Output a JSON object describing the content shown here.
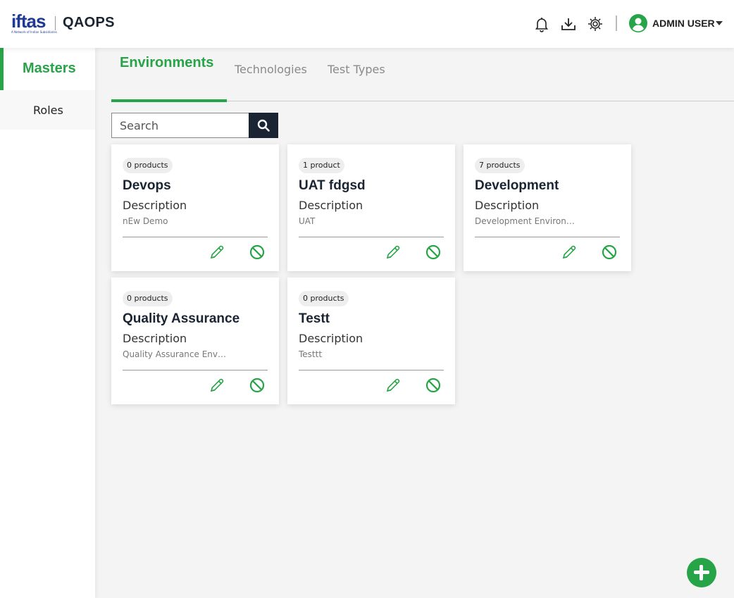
{
  "header": {
    "logo_text": "iftas",
    "logo_subtitle": "A Network of Indian Subsidiaries",
    "app_name": "QAOPS",
    "user_name": "ADMIN USER",
    "icons": [
      "bell-icon",
      "download-icon",
      "settings-icon",
      "user-avatar-icon",
      "caret-down-icon"
    ]
  },
  "sidebar": {
    "items": [
      {
        "label": "Masters",
        "active": true
      },
      {
        "label": "Roles",
        "active": false
      }
    ]
  },
  "tabs": [
    {
      "label": "Environments",
      "active": true
    },
    {
      "label": "Technologies",
      "active": false
    },
    {
      "label": "Test Types",
      "active": false
    }
  ],
  "search": {
    "placeholder": "Search",
    "value": ""
  },
  "cards": [
    {
      "badge": "0 products",
      "title": "Devops",
      "desc_label": "Description",
      "desc": "nEw Demo"
    },
    {
      "badge": "1 product",
      "title": "UAT fdgsd",
      "desc_label": "Description",
      "desc": "UAT"
    },
    {
      "badge": "7 products",
      "title": "Development",
      "desc_label": "Description",
      "desc": "Development Environment"
    },
    {
      "badge": "0 products",
      "title": "Quality Assurance",
      "desc_label": "Description",
      "desc": "Quality Assurance Environment"
    },
    {
      "badge": "0 products",
      "title": "Testt",
      "desc_label": "Description",
      "desc": "Testtt"
    }
  ],
  "colors": {
    "accent": "#27a447",
    "dark": "#1a2433",
    "brand_blue": "#1f3a93"
  }
}
